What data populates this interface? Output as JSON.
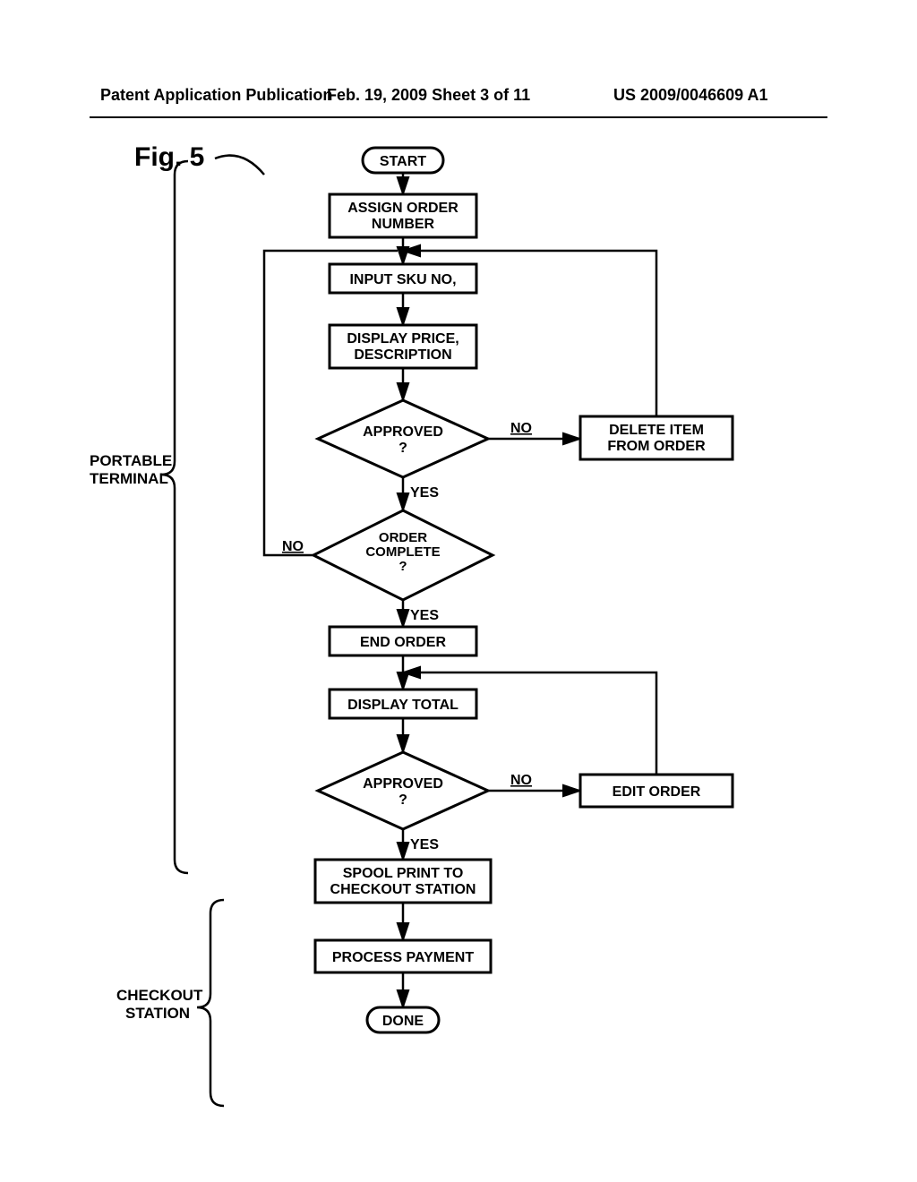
{
  "header": {
    "left": "Patent Application Publication",
    "center": "Feb. 19, 2009  Sheet 3 of 11",
    "right": "US 2009/0046609 A1"
  },
  "figure_label": "Fig. 5",
  "groups": {
    "portable": "PORTABLE\nTERMINAL",
    "checkout": "CHECKOUT\nSTATION"
  },
  "nodes": {
    "start": "START",
    "assign": "ASSIGN ORDER\nNUMBER",
    "input_sku": "INPUT SKU NO,",
    "display_price": "DISPLAY PRICE,\nDESCRIPTION",
    "approved1": "APPROVED\n?",
    "delete_item": "DELETE ITEM\nFROM ORDER",
    "order_complete": "ORDER\nCOMPLETE\n?",
    "end_order": "END ORDER",
    "display_total": "DISPLAY TOTAL",
    "approved2": "APPROVED\n?",
    "edit_order": "EDIT ORDER",
    "spool": "SPOOL PRINT TO\nCHECKOUT STATION",
    "process_payment": "PROCESS PAYMENT",
    "done": "DONE"
  },
  "edges": {
    "yes": "YES",
    "no": "NO"
  },
  "chart_data": {
    "type": "flowchart",
    "title": "Fig. 5",
    "groups": [
      {
        "id": "portable",
        "label": "PORTABLE TERMINAL",
        "nodes": [
          "start",
          "assign",
          "input_sku",
          "display_price",
          "approved1",
          "delete_item",
          "order_complete",
          "end_order",
          "display_total",
          "approved2",
          "edit_order"
        ]
      },
      {
        "id": "checkout",
        "label": "CHECKOUT STATION",
        "nodes": [
          "spool",
          "process_payment",
          "done"
        ]
      }
    ],
    "nodes": [
      {
        "id": "start",
        "shape": "terminator",
        "label": "START"
      },
      {
        "id": "assign",
        "shape": "process",
        "label": "ASSIGN ORDER NUMBER"
      },
      {
        "id": "input_sku",
        "shape": "process",
        "label": "INPUT SKU NO,"
      },
      {
        "id": "display_price",
        "shape": "process",
        "label": "DISPLAY PRICE, DESCRIPTION"
      },
      {
        "id": "approved1",
        "shape": "decision",
        "label": "APPROVED ?"
      },
      {
        "id": "delete_item",
        "shape": "process",
        "label": "DELETE ITEM FROM ORDER"
      },
      {
        "id": "order_complete",
        "shape": "decision",
        "label": "ORDER COMPLETE ?"
      },
      {
        "id": "end_order",
        "shape": "process",
        "label": "END ORDER"
      },
      {
        "id": "display_total",
        "shape": "process",
        "label": "DISPLAY TOTAL"
      },
      {
        "id": "approved2",
        "shape": "decision",
        "label": "APPROVED ?"
      },
      {
        "id": "edit_order",
        "shape": "process",
        "label": "EDIT ORDER"
      },
      {
        "id": "spool",
        "shape": "process",
        "label": "SPOOL PRINT TO CHECKOUT STATION"
      },
      {
        "id": "process_payment",
        "shape": "process",
        "label": "PROCESS PAYMENT"
      },
      {
        "id": "done",
        "shape": "terminator",
        "label": "DONE"
      }
    ],
    "edges": [
      {
        "from": "start",
        "to": "assign"
      },
      {
        "from": "assign",
        "to": "input_sku"
      },
      {
        "from": "input_sku",
        "to": "display_price"
      },
      {
        "from": "display_price",
        "to": "approved1"
      },
      {
        "from": "approved1",
        "to": "order_complete",
        "label": "YES"
      },
      {
        "from": "approved1",
        "to": "delete_item",
        "label": "NO"
      },
      {
        "from": "delete_item",
        "to": "input_sku"
      },
      {
        "from": "order_complete",
        "to": "end_order",
        "label": "YES"
      },
      {
        "from": "order_complete",
        "to": "input_sku",
        "label": "NO"
      },
      {
        "from": "end_order",
        "to": "display_total"
      },
      {
        "from": "display_total",
        "to": "approved2"
      },
      {
        "from": "approved2",
        "to": "spool",
        "label": "YES"
      },
      {
        "from": "approved2",
        "to": "edit_order",
        "label": "NO"
      },
      {
        "from": "edit_order",
        "to": "display_total"
      },
      {
        "from": "spool",
        "to": "process_payment"
      },
      {
        "from": "process_payment",
        "to": "done"
      }
    ]
  }
}
